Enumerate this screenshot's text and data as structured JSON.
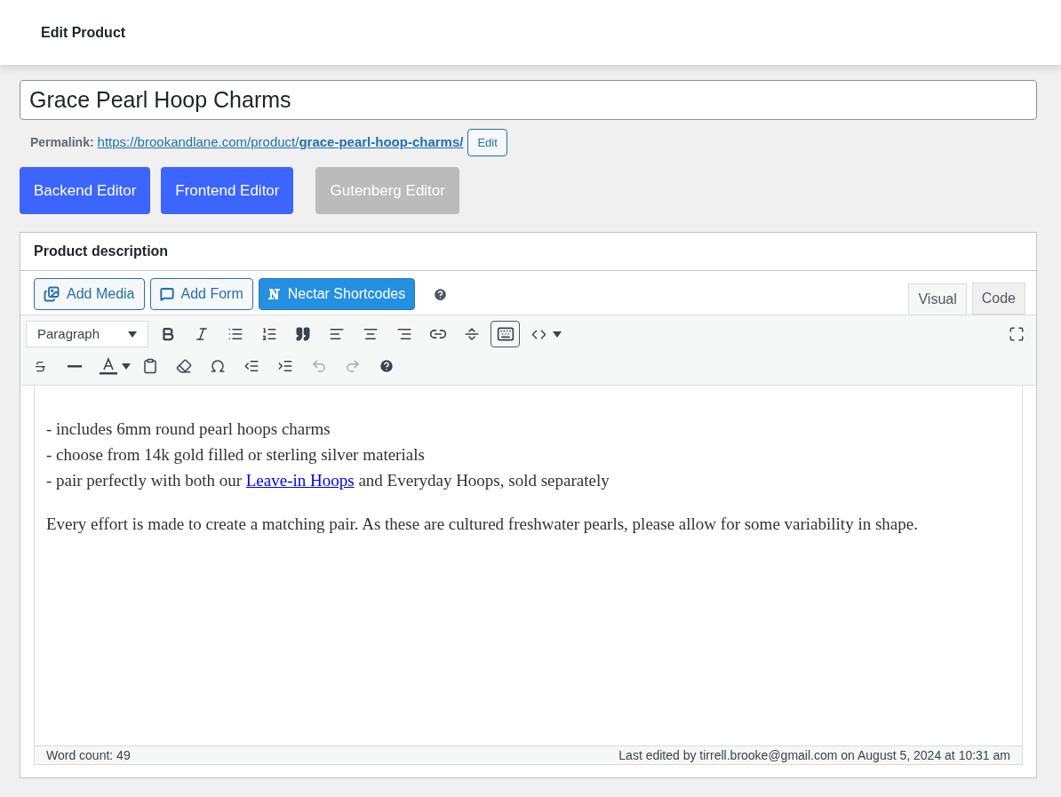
{
  "header": {
    "title": "Edit Product"
  },
  "title_field": {
    "value": "Grace Pearl Hoop Charms"
  },
  "permalink": {
    "label": "Permalink:",
    "base": "https://brookandlane.com/product/",
    "slug": "grace-pearl-hoop-charms/",
    "edit_button": "Edit"
  },
  "editor_buttons": [
    {
      "label": "Backend Editor",
      "disabled": false
    },
    {
      "label": "Frontend Editor",
      "disabled": false
    },
    {
      "label": "Gutenberg Editor",
      "disabled": true
    }
  ],
  "postbox": {
    "title": "Product description"
  },
  "media_buttons": [
    {
      "kind": "media",
      "label": "Add Media"
    },
    {
      "kind": "form",
      "label": "Add Form"
    },
    {
      "kind": "nectar",
      "label": "Nectar Shortcodes"
    }
  ],
  "editor_tabs": [
    {
      "label": "Visual",
      "selected": true
    },
    {
      "label": "Code",
      "selected": false
    }
  ],
  "toolbar": {
    "format_select": "Paragraph",
    "toolbar_toggle_pressed": true,
    "undo_disabled": true,
    "redo_disabled": true
  },
  "content": [
    {
      "lines": [
        [
          {
            "kind": "text",
            "text": "- includes 6mm round pearl hoops charms"
          }
        ],
        [
          {
            "kind": "text",
            "text": "- choose from 14k gold filled or sterling silver materials"
          }
        ],
        [
          {
            "kind": "text",
            "text": "- pair perfectly with both our "
          },
          {
            "kind": "link",
            "text": "Leave-in Hoops"
          },
          {
            "kind": "text",
            "text": " and Everyday Hoops, sold separately"
          }
        ]
      ]
    },
    {
      "lines": [
        [
          {
            "kind": "text",
            "text": "Every effort is made to create a matching pair. As these are cultured freshwater pearls, please allow for some variability in shape."
          }
        ]
      ]
    }
  ],
  "status_bar": {
    "word_count": "Word count: 49",
    "last_edited": "Last edited by tirrell.brooke@gmail.com on August 5, 2024 at 10:31 am"
  }
}
